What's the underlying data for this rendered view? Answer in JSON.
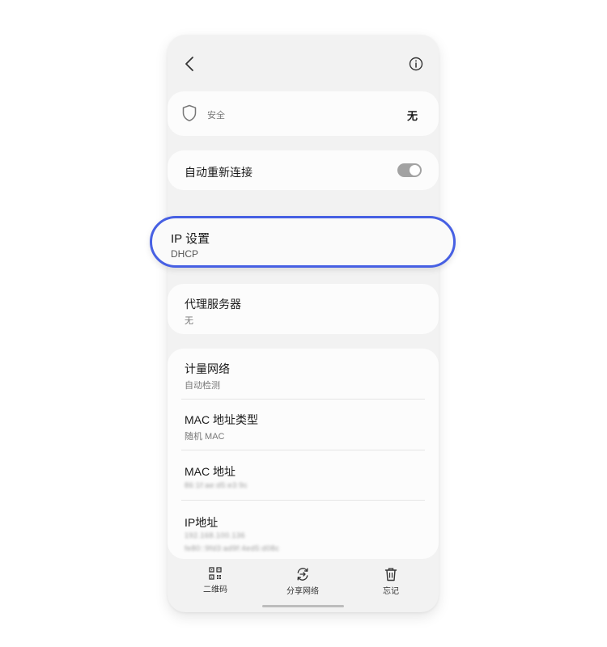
{
  "security": {
    "label": "安全",
    "value": "无"
  },
  "auto_reconnect": {
    "label": "自动重新连接",
    "enabled": true
  },
  "ip_settings": {
    "title": "IP 设置",
    "value": "DHCP"
  },
  "proxy": {
    "title": "代理服务器",
    "value": "无"
  },
  "metered": {
    "title": "计量网络",
    "value": "自动检测"
  },
  "mac_type": {
    "title": "MAC 地址类型",
    "value": "随机 MAC"
  },
  "mac_address": {
    "title": "MAC 地址",
    "value": "86:1f:ae:d5:e3:9c"
  },
  "ip_address": {
    "title": "IP地址",
    "value_v4": "192.168.100.136",
    "value_v6": "fe80::9fd3:ad9f:4ed5:d08c"
  },
  "bottom_bar": {
    "qr_label": "二维码",
    "share_label": "分享网络",
    "forget_label": "忘记"
  },
  "colors": {
    "highlight": "#4760e3",
    "background": "#f2f2f2",
    "card": "#fcfcfc"
  }
}
